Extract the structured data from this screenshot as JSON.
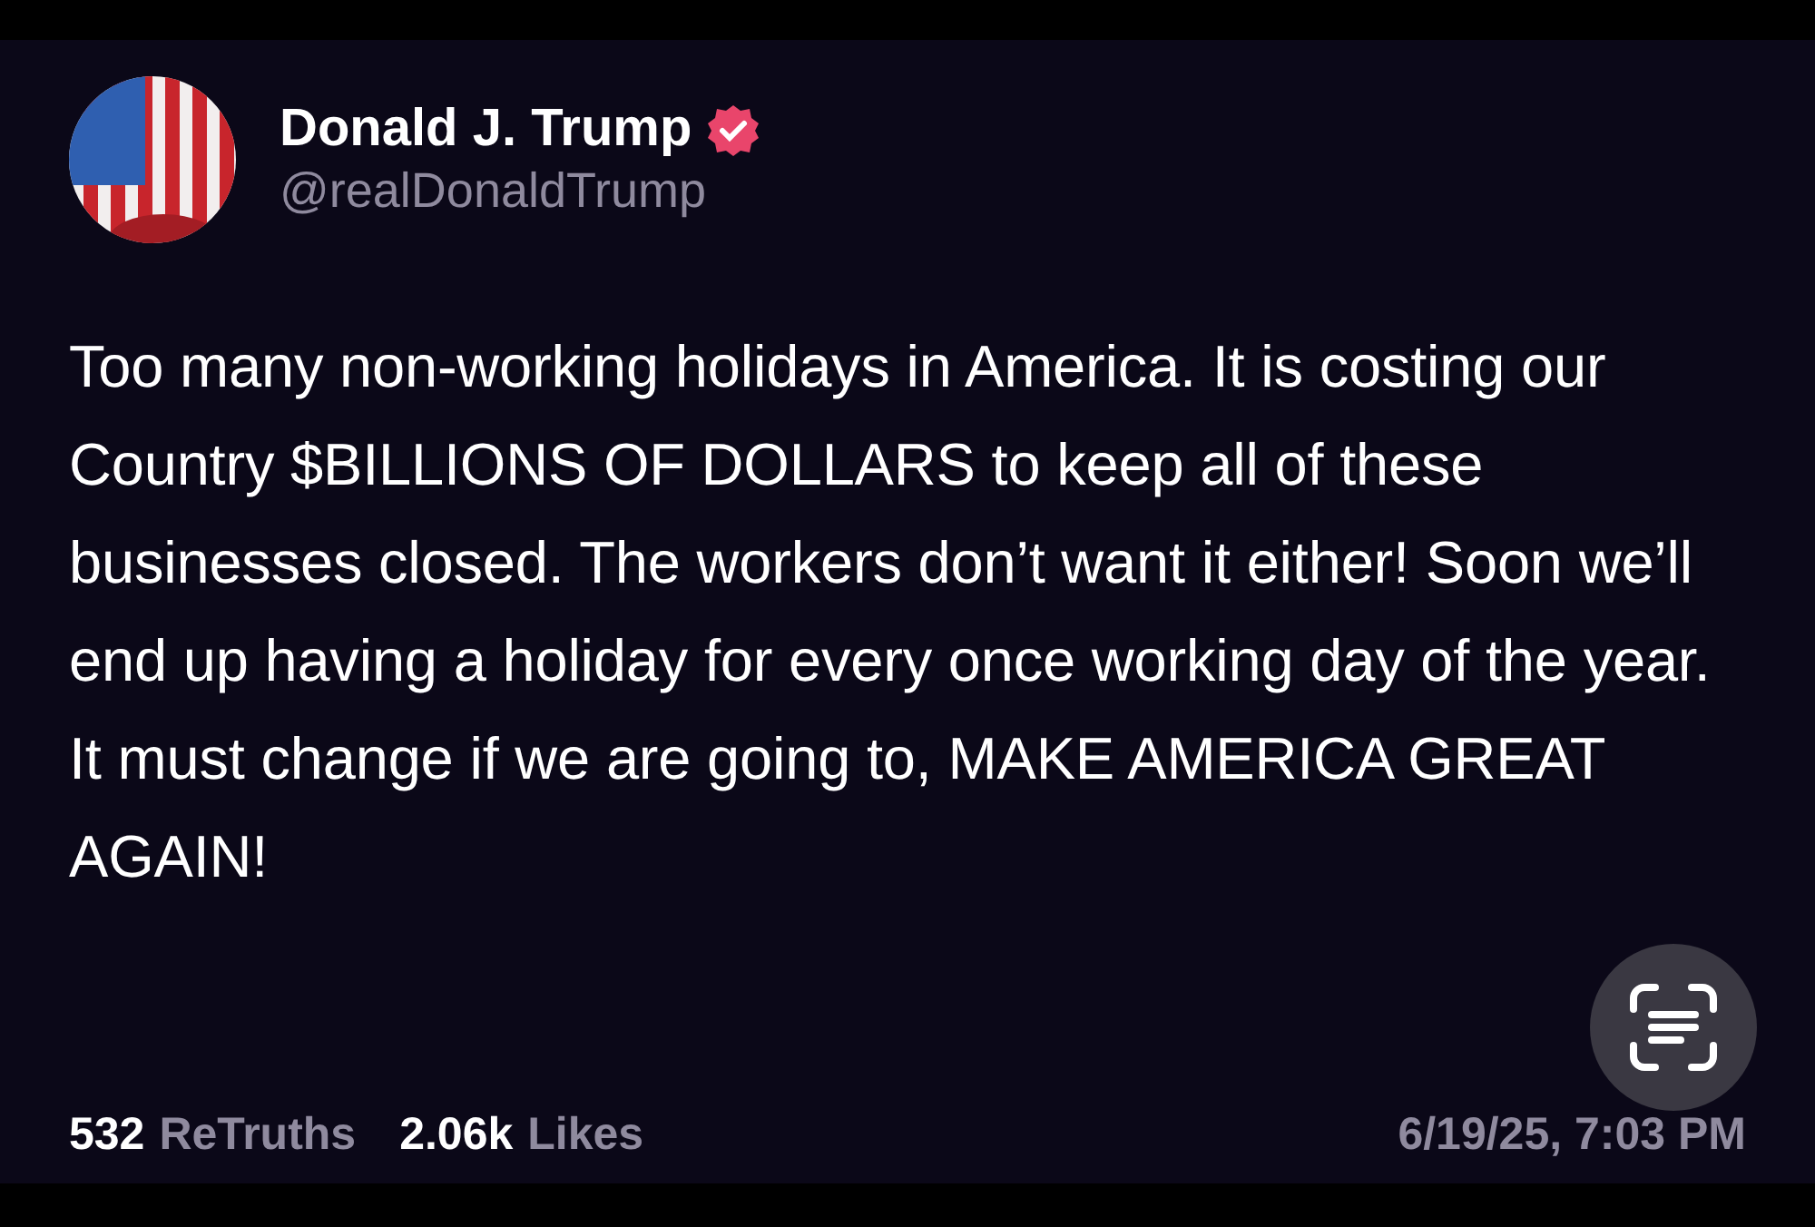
{
  "post": {
    "author": {
      "name": "Donald J. Trump",
      "verified": true,
      "handle": "@realDonaldTrump"
    },
    "text": "Too many non-working holidays in America. It is costing our Country $BILLIONS OF DOLLARS to keep all of these businesses closed. The workers don’t want it either! Soon we’ll end up having a holiday for every once working day of the year. It must change if we are going to, MAKE AMERICA GREAT AGAIN!",
    "stats": [
      {
        "count": "532",
        "label": "ReTruths"
      },
      {
        "count": "2.06k",
        "label": "Likes"
      }
    ],
    "timestamp": "6/19/25, 7:03 PM"
  }
}
